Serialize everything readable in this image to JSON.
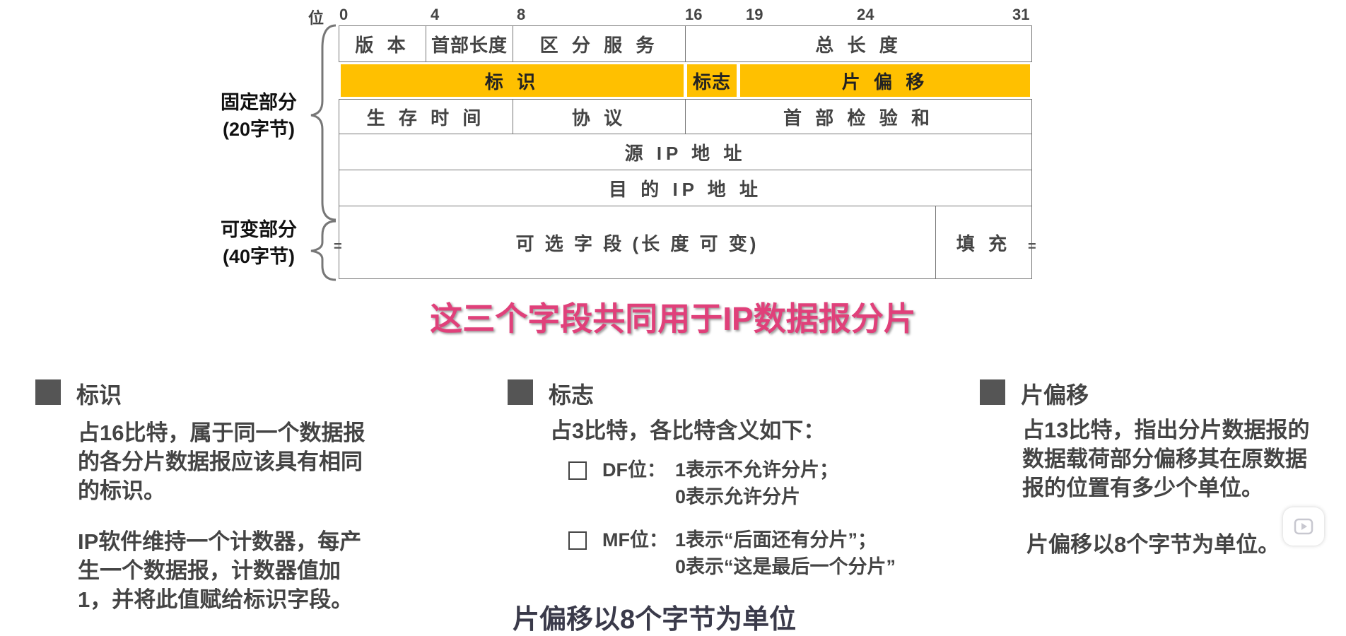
{
  "header": {
    "bit_label": "位",
    "bit_numbers": [
      "0",
      "4",
      "8",
      "16",
      "19",
      "24",
      "31"
    ]
  },
  "rows": [
    [
      {
        "text": "版 本"
      },
      {
        "text": "首部长度"
      },
      {
        "text": "区 分 服 务"
      },
      {
        "text": "总   长   度"
      }
    ],
    [
      {
        "text": "标      识"
      },
      {
        "text": "标志"
      },
      {
        "text": "片 偏 移"
      }
    ],
    [
      {
        "text": "生 存 时 间"
      },
      {
        "text": "协      议"
      },
      {
        "text": "首 部 检 验 和"
      }
    ],
    [
      {
        "text": "源 IP 地 址"
      }
    ],
    [
      {
        "text": "目 的 IP 地 址"
      }
    ],
    [
      {
        "text": "可 选 字 段 (长 度 可 变)"
      },
      {
        "text": "填 充"
      }
    ]
  ],
  "labels": {
    "fixed": "固定部分",
    "fixed_size": "(20字节)",
    "variable": "可变部分",
    "variable_size": "(40字节)"
  },
  "marks": {
    "left": "=",
    "right": "="
  },
  "caption": "这三个字段共同用于IP数据报分片",
  "sections": {
    "identification": {
      "title": "标识",
      "p1": [
        "占16比特，属于同一个数据报",
        "的各分片数据报应该具有相同",
        "的标识。"
      ],
      "p2": [
        "IP软件维持一个计数器，每产",
        "生一个数据报，计数器值加",
        "1，并将此值赋给标识字段。"
      ]
    },
    "flags": {
      "title": "标志",
      "intro": "占3比特，各比特含义如下：",
      "df_label": "DF位：",
      "df_lines": [
        "1表示不允许分片；",
        "0表示允许分片"
      ],
      "mf_label": "MF位：",
      "mf_lines": [
        "1表示“后面还有分片”；",
        "0表示“这是最后一个分片”"
      ]
    },
    "offset": {
      "title": "片偏移",
      "p1": [
        "占13比特，指出分片数据报的",
        "数据载荷部分偏移其在原数据",
        "报的位置有多少个单位。"
      ],
      "p2": "片偏移以8个字节为单位。"
    }
  },
  "bottom_subtitle": "片偏移以8个字节为单位",
  "colors": {
    "highlight": "#ffc000",
    "caption": "#e0407a"
  }
}
